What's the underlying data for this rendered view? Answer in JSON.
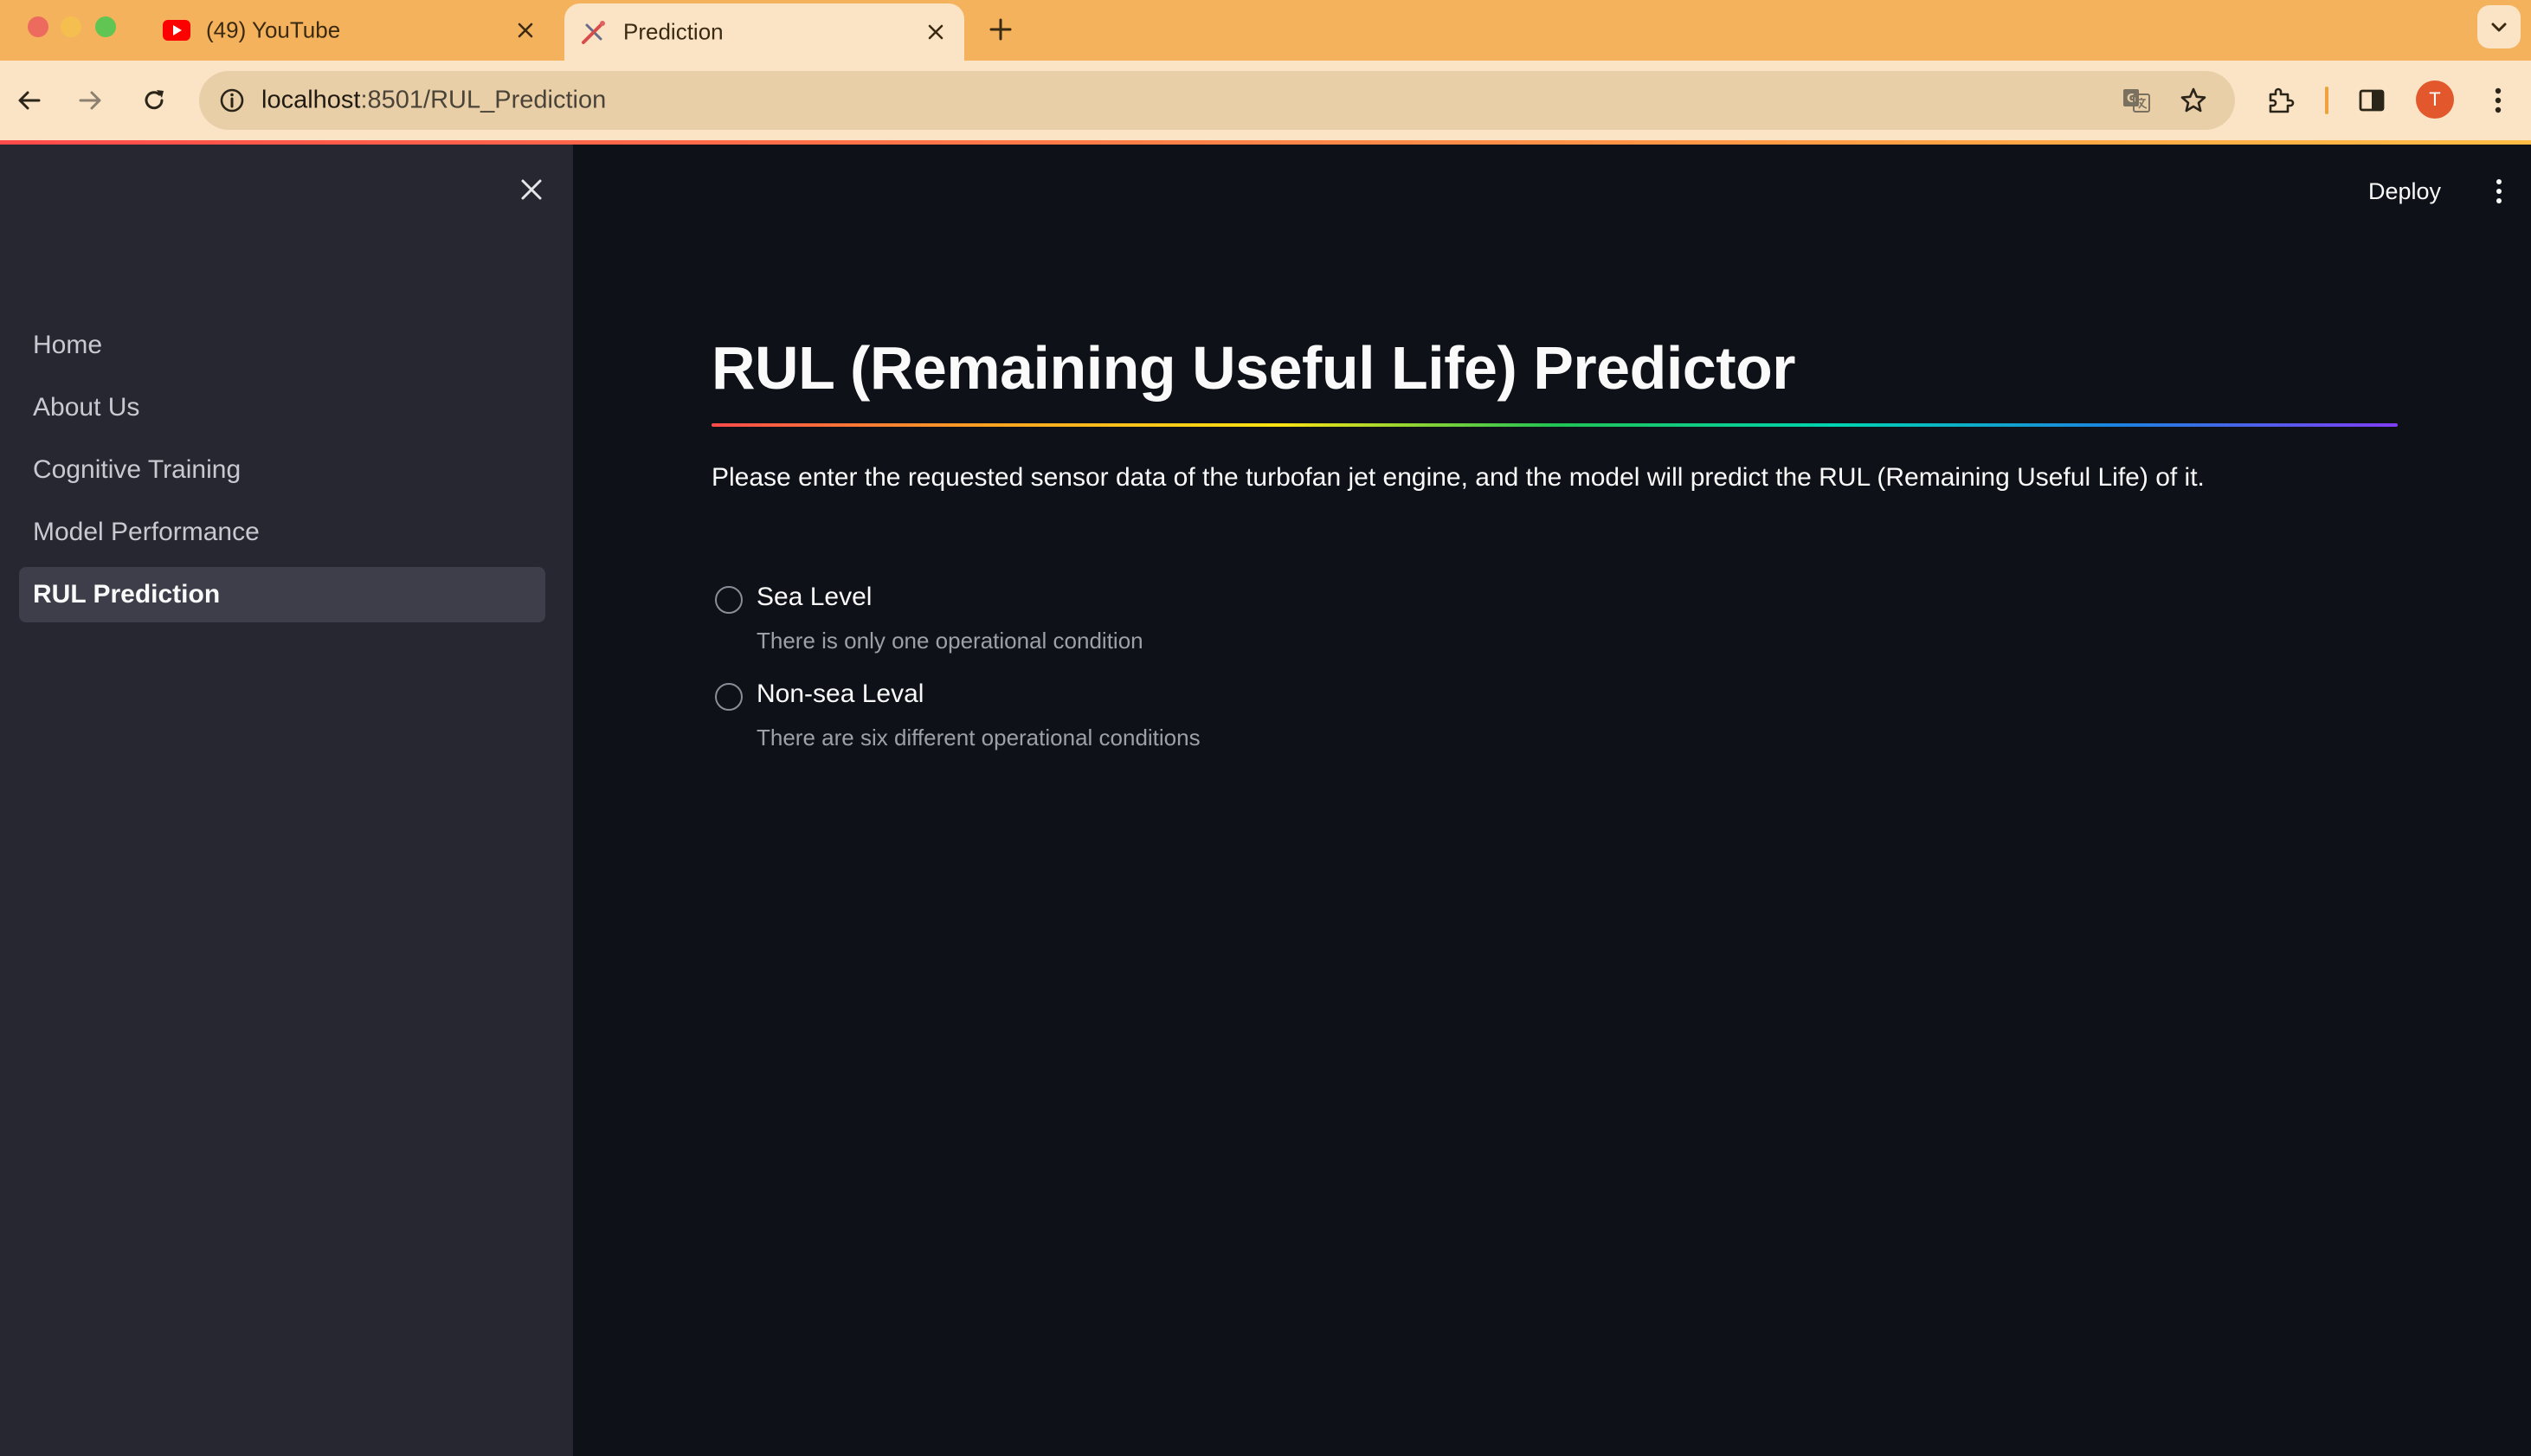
{
  "browser": {
    "tabs": [
      {
        "title": "(49) YouTube",
        "icon": "youtube-icon",
        "active": false
      },
      {
        "title": "Prediction",
        "icon": "app-favicon-icon",
        "active": true
      }
    ],
    "url_host": "localhost",
    "url_path": ":8501/RUL_Prediction",
    "profile_initial": "T"
  },
  "sidebar": {
    "items": [
      {
        "label": "Home",
        "active": false
      },
      {
        "label": "About Us",
        "active": false
      },
      {
        "label": "Cognitive Training",
        "active": false
      },
      {
        "label": "Model Performance",
        "active": false
      },
      {
        "label": "RUL Prediction",
        "active": true
      }
    ]
  },
  "header": {
    "deploy_label": "Deploy"
  },
  "main": {
    "title": "RUL (Remaining Useful Life) Predictor",
    "description": "Please enter the requested sensor data of the turbofan jet engine, and the model will predict the RUL (Remaining Useful Life) of it.",
    "options": [
      {
        "label": "Sea Level",
        "caption": "There is only one operational condition",
        "selected": false
      },
      {
        "label": "Non-sea Leval",
        "caption": "There are six different operational conditions",
        "selected": false
      }
    ]
  },
  "colors": {
    "tabbar": "#f4b25c",
    "toolbar": "#fbe4c6",
    "sidebar": "#262730",
    "main_bg": "#0e1117",
    "accent": "#ff4b4b"
  }
}
